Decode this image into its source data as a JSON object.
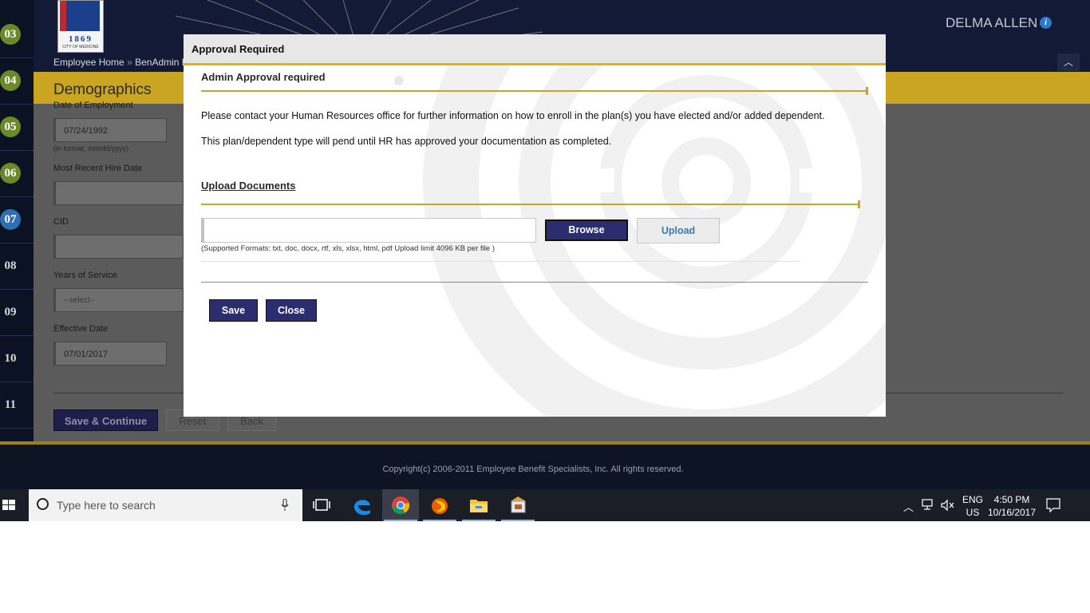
{
  "header": {
    "logo_year": "1869",
    "logo_city": "CITY OF MEDICINE",
    "user_name": "DELMA ALLEN",
    "breadcrumb": [
      "Employee Home",
      "BenAdmin Em"
    ],
    "breadcrumb_sep": "»"
  },
  "steps": [
    "03",
    "04",
    "05",
    "06",
    "07",
    "08",
    "09",
    "10",
    "11"
  ],
  "page": {
    "title": "Demographics",
    "fields": {
      "employment_date_label": "Date of Employment",
      "employment_date_value": "07/24/1992",
      "date_hint": "(in format, mm/dd/yyyy)",
      "hire_date_label": "Most Recent Hire Date",
      "cid_label": "CID",
      "years_label": "Years of Service",
      "years_value": "--select--",
      "effective_date_label": "Effective Date",
      "effective_date_value": "07/01/2017"
    },
    "buttons": {
      "save_continue": "Save & Continue",
      "reset": "Reset",
      "back": "Back"
    }
  },
  "footer": {
    "copyright": "Copyright(c) 2006-2011 Employee Benefit Specialists, Inc. All rights reserved."
  },
  "modal": {
    "title": "Approval Required",
    "section_title": "Admin Approval required",
    "message_1": "Please contact your Human Resources office for further information on how to enroll in the plan(s) you have elected and/or added dependent.",
    "message_2": "This plan/dependent type will pend until HR has approved your documentation as completed.",
    "upload_title": "Upload Documents",
    "file_value": "",
    "browse_label": "Browse",
    "upload_label": "Upload",
    "formats_note": "(Supported Formats: txt, doc, docx, rtf, xls, xlsx, html, pdf Upload limit 4096 KB per file )",
    "save_label": "Save",
    "close_label": "Close"
  },
  "taskbar": {
    "search_placeholder": "Type here to search",
    "lang_line1": "ENG",
    "lang_line2": "US",
    "time": "4:50 PM",
    "date": "10/16/2017",
    "icons": [
      "task-view-icon",
      "edge-icon",
      "chrome-icon",
      "firefox-icon",
      "file-explorer-icon",
      "app-icon"
    ]
  },
  "colors": {
    "accent_gold": "#c9a521",
    "button_navy": "#2b2d6e",
    "header_navy": "#121a35"
  }
}
